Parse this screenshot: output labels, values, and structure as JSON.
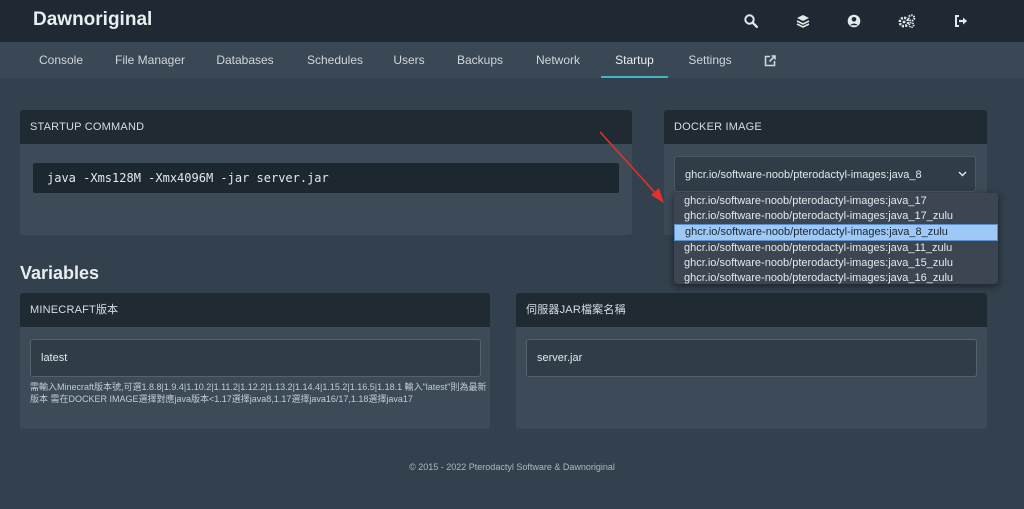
{
  "app": {
    "title": "Dawnoriginal"
  },
  "header_icons": [
    "search-icon",
    "layers-icon",
    "user-icon",
    "cogs-icon",
    "sign-out-icon"
  ],
  "tabs": [
    {
      "label": "Console"
    },
    {
      "label": "File Manager"
    },
    {
      "label": "Databases"
    },
    {
      "label": "Schedules"
    },
    {
      "label": "Users"
    },
    {
      "label": "Backups"
    },
    {
      "label": "Network"
    },
    {
      "label": "Startup"
    },
    {
      "label": "Settings"
    }
  ],
  "active_tab": "Startup",
  "startup": {
    "header": "STARTUP COMMAND",
    "command": "java -Xms128M -Xmx4096M -jar server.jar"
  },
  "docker": {
    "header": "DOCKER IMAGE",
    "selected": "ghcr.io/software-noob/pterodactyl-images:java_8",
    "options": [
      "ghcr.io/software-noob/pterodactyl-images:java_17",
      "ghcr.io/software-noob/pterodactyl-images:java_17_zulu",
      "ghcr.io/software-noob/pterodactyl-images:java_8_zulu",
      "ghcr.io/software-noob/pterodactyl-images:java_11_zulu",
      "ghcr.io/software-noob/pterodactyl-images:java_15_zulu",
      "ghcr.io/software-noob/pterodactyl-images:java_16_zulu"
    ],
    "highlighted_index": 2
  },
  "variables": {
    "title": "Variables",
    "items": [
      {
        "header": "MINECRAFT版本",
        "value": "latest",
        "description": "需輸入Minecraft版本號,可選1.8.8|1.9.4|1.10.2|1.11.2|1.12.2|1.13.2|1.14.4|1.15.2|1.16.5|1.18.1 輸入\"latest\"則為最新版本 需在DOCKER IMAGE選擇對應java版本<1.17選擇java8,1.17選擇java16/17,1.18選擇java17"
      },
      {
        "header": "伺服器JAR檔案名稱",
        "value": "server.jar",
        "description": ""
      }
    ]
  },
  "footer": "© 2015 - 2022 Pterodactyl Software & Dawnoriginal",
  "colors": {
    "accent": "#3fb6c2",
    "annotation_arrow": "#e0312b",
    "highlight": "#9ec8f5"
  }
}
